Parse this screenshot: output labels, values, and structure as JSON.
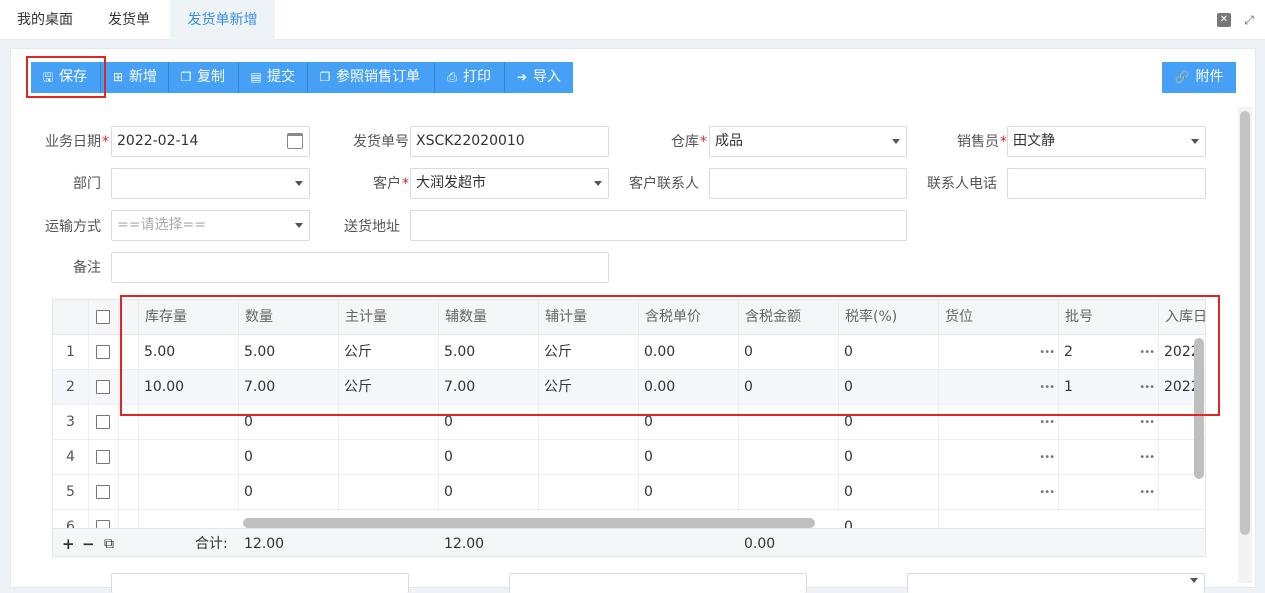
{
  "tabs": [
    {
      "label": "我的桌面"
    },
    {
      "label": "发货单"
    },
    {
      "label": "发货单新增"
    }
  ],
  "window": {
    "close_symbol": "✕",
    "fullscreen_symbol": "⤢"
  },
  "toolbar": {
    "save": "保存",
    "add": "新增",
    "copy": "复制",
    "submit": "提交",
    "ref_order": "参照销售订单",
    "print": "打印",
    "import": "导入",
    "attach": "附件"
  },
  "icons": {
    "save": "🖫",
    "add": "⊞",
    "copy": "❐",
    "submit": "▤",
    "ref": "❐",
    "print": "⎙",
    "import": "➔",
    "attach": "🔗"
  },
  "form": {
    "biz_date_label": "业务日期",
    "biz_date_value": "2022-02-14",
    "doc_no_label": "发货单号",
    "doc_no_value": "XSCK22020010",
    "warehouse_label": "仓库",
    "warehouse_value": "成品",
    "salesman_label": "销售员",
    "salesman_value": "田文静",
    "dept_label": "部门",
    "dept_value": "",
    "customer_label": "客户",
    "customer_value": "大润发超市",
    "contact_label": "客户联系人",
    "contact_value": "",
    "contact_phone_label": "联系人电话",
    "contact_phone_value": "",
    "transport_label": "运输方式",
    "transport_placeholder": "==请选择==",
    "address_label": "送货地址",
    "address_value": "",
    "remark_label": "备注",
    "remark_value": "",
    "required_mark": "*"
  },
  "grid": {
    "columns": [
      "库存量",
      "数量",
      "主计量",
      "辅数量",
      "辅计量",
      "含税单价",
      "含税金额",
      "税率(%)",
      "货位",
      "批号",
      "入库日"
    ],
    "rows": [
      {
        "no": "1",
        "stock": "5.00",
        "qty": "5.00",
        "unit": "公斤",
        "aux_qty": "5.00",
        "aux_unit": "公斤",
        "price": "0.00",
        "amount": "0",
        "tax": "0",
        "loc": "",
        "batch": "2",
        "date": "2022"
      },
      {
        "no": "2",
        "stock": "10.00",
        "qty": "7.00",
        "unit": "公斤",
        "aux_qty": "7.00",
        "aux_unit": "公斤",
        "price": "0.00",
        "amount": "0",
        "tax": "0",
        "loc": "",
        "batch": "1",
        "date": "2022"
      },
      {
        "no": "3",
        "stock": "",
        "qty": "0",
        "unit": "",
        "aux_qty": "0",
        "aux_unit": "",
        "price": "0",
        "amount": "",
        "tax": "0",
        "loc": "",
        "batch": "",
        "date": ""
      },
      {
        "no": "4",
        "stock": "",
        "qty": "0",
        "unit": "",
        "aux_qty": "0",
        "aux_unit": "",
        "price": "0",
        "amount": "",
        "tax": "0",
        "loc": "",
        "batch": "",
        "date": ""
      },
      {
        "no": "5",
        "stock": "",
        "qty": "0",
        "unit": "",
        "aux_qty": "0",
        "aux_unit": "",
        "price": "0",
        "amount": "",
        "tax": "0",
        "loc": "",
        "batch": "",
        "date": ""
      },
      {
        "no": "6",
        "stock": "",
        "qty": "",
        "unit": "",
        "aux_qty": "",
        "aux_unit": "",
        "price": "",
        "amount": "",
        "tax": "0",
        "loc": "",
        "batch": "",
        "date": ""
      }
    ],
    "dots": "•••",
    "footer": {
      "plus": "+",
      "minus": "−",
      "copy_symbol": "⧉",
      "total_label": "合计:",
      "qty_total": "12.00",
      "aux_qty_total": "12.00",
      "amount_total": "0.00"
    }
  },
  "colors": {
    "accent": "#45a0f6",
    "highlight": "#e02525",
    "active_tab": "#3a8ee6"
  }
}
